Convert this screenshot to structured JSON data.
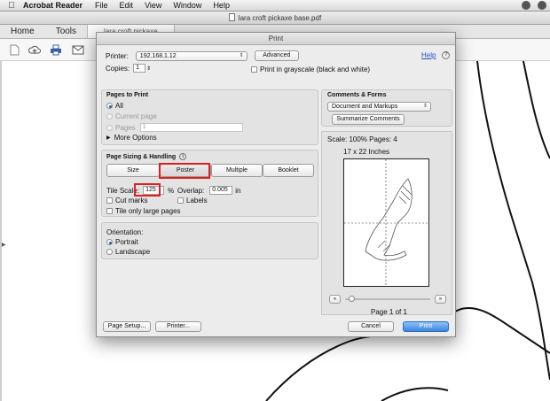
{
  "menubar": {
    "app_name": "Acrobat Reader",
    "menus": [
      "File",
      "Edit",
      "View",
      "Window",
      "Help"
    ]
  },
  "window": {
    "title": "lara croft pickaxe base.pdf"
  },
  "app_tabs": {
    "home": "Home",
    "tools": "Tools",
    "doc": "lara croft pickaxe"
  },
  "toolbar_icons": [
    "new-file-icon",
    "cloud-upload-icon",
    "print-icon",
    "mail-icon"
  ],
  "dialog": {
    "title": "Print",
    "printer_label": "Printer:",
    "printer_value": "192.168.1.12",
    "advanced_button": "Advanced",
    "help_link": "Help",
    "copies_label": "Copies:",
    "copies_value": "1",
    "grayscale_label": "Print in grayscale (black and white)",
    "pages_to_print": {
      "title": "Pages to Print",
      "all": "All",
      "current_page": "Current page",
      "pages": "Pages",
      "pages_value": "1",
      "more_options": "More Options"
    },
    "sizing": {
      "title": "Page Sizing & Handling",
      "modes": [
        "Size",
        "Poster",
        "Multiple",
        "Booklet"
      ],
      "selected_mode": "Poster",
      "tile_scale_label": "Tile Scale:",
      "tile_scale_value": "125",
      "percent": "%",
      "overlap_label": "Overlap:",
      "overlap_value": "0.005",
      "overlap_unit": "in",
      "cut_marks": "Cut marks",
      "labels": "Labels",
      "tile_only_large": "Tile only large pages"
    },
    "orientation": {
      "title": "Orientation:",
      "portrait": "Portrait",
      "landscape": "Landscape",
      "selected": "Portrait"
    },
    "comments_forms": {
      "title": "Comments & Forms",
      "value": "Document and Markups",
      "summarize_button": "Summarize Comments"
    },
    "preview": {
      "scale_text": "Scale: 100% Pages: 4",
      "paper_size": "17 x 22 Inches",
      "page_text": "Page 1 of 1",
      "prev_icon": "«",
      "next_icon": "»"
    },
    "footer": {
      "page_setup": "Page Setup...",
      "printer": "Printer...",
      "cancel": "Cancel",
      "print": "Print"
    },
    "colors": {
      "highlight": "#e02020",
      "accent": "#3b86e0"
    }
  }
}
